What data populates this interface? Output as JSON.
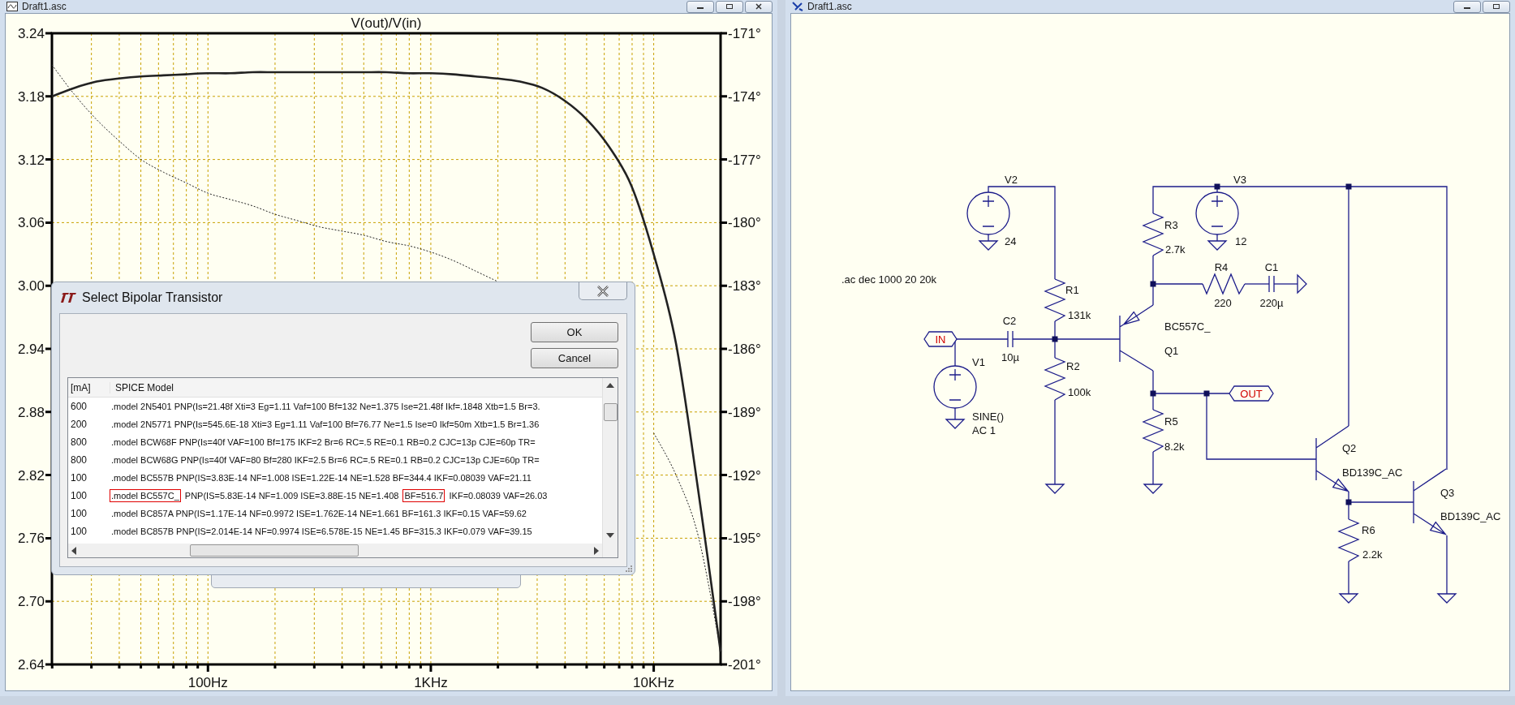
{
  "plot_window": {
    "title": "Draft1.asc",
    "chart_data": {
      "type": "line",
      "title": "V(out)/V(in)",
      "categories": [
        null,
        null,
        null,
        null,
        null,
        null,
        null,
        "100Hz",
        null,
        null,
        null,
        null,
        null,
        null,
        null,
        null,
        null,
        "1KHz",
        null,
        null,
        null,
        null,
        null,
        null,
        null,
        null,
        null,
        "10KHz",
        null,
        null,
        null
      ],
      "ylim": [
        2.64,
        3.24
      ],
      "y2lim": [
        -201,
        -171
      ],
      "grid": true,
      "yticks": [
        {
          "value": 3.24,
          "label": "3.24"
        },
        {
          "value": 3.18,
          "label": "3.18"
        },
        {
          "value": 3.12,
          "label": "3.12"
        },
        {
          "value": 3.06,
          "label": "3.06"
        },
        {
          "value": 3.0,
          "label": "3.00"
        },
        {
          "value": 2.94,
          "label": "2.94"
        },
        {
          "value": 2.88,
          "label": "2.88"
        },
        {
          "value": 2.82,
          "label": "2.82"
        },
        {
          "value": 2.76,
          "label": "2.76"
        },
        {
          "value": 2.7,
          "label": "2.70"
        },
        {
          "value": 2.64,
          "label": "2.64"
        }
      ],
      "y2ticks": [
        {
          "value": -171,
          "label": "-171°"
        },
        {
          "value": -174,
          "label": "-174°"
        },
        {
          "value": -177,
          "label": "-177°"
        },
        {
          "value": -180,
          "label": "-180°"
        },
        {
          "value": -183,
          "label": "-183°"
        },
        {
          "value": -186,
          "label": "-186°"
        },
        {
          "value": -189,
          "label": "-189°"
        },
        {
          "value": -192,
          "label": "-192°"
        },
        {
          "value": -195,
          "label": "-195°"
        },
        {
          "value": -198,
          "label": "-198°"
        },
        {
          "value": -201,
          "label": "-201°"
        }
      ],
      "series": [
        {
          "values": [
            3.18,
            3.188,
            3.194,
            3.197,
            3.199,
            3.2,
            3.201,
            3.202,
            3.202,
            3.203,
            3.203,
            3.203,
            3.203,
            3.203,
            3.203,
            3.203,
            3.202,
            3.202,
            3.201,
            3.199,
            3.197,
            3.194,
            3.188,
            3.176,
            3.158,
            3.132,
            3.095,
            3.03,
            2.945,
            2.805,
            2.652
          ]
        },
        {
          "axis": "y2",
          "line_style": "dotted",
          "values": [
            -172.5,
            -173.9,
            -175.1,
            -176.1,
            -177,
            -177.6,
            -178.1,
            -178.6,
            -178.9,
            -179.2,
            -179.6,
            -179.9,
            -180.2,
            -180.4,
            -180.6,
            -180.9,
            -181.1,
            -181.4,
            -181.8,
            -182.3,
            -182.8,
            null,
            null,
            null,
            null,
            null,
            null,
            -190,
            -192,
            -194.9,
            -200.3
          ]
        }
      ]
    }
  },
  "dialog": {
    "title": "Select Bipolar Transistor",
    "buttons": [
      "OK",
      "Cancel"
    ],
    "columns": [
      "[mA]",
      "SPICE Model"
    ],
    "rows": [
      {
        "current": "600",
        "model": [
          {
            "text": ".model 2N5401 PNP(Is=21.48f Xti=3 Eg=1.11 Vaf=100 Bf=132 Ne=1.375 Ise=21.48f Ikf=.1848 Xtb=1.5 Br=3.",
            "highlighted": false
          }
        ]
      },
      {
        "current": "200",
        "model": [
          {
            "text": ".model 2N5771 PNP(Is=545.6E-18 Xti=3 Eg=1.11 Vaf=100 Bf=76.77 Ne=1.5 Ise=0 Ikf=50m Xtb=1.5 Br=1.36",
            "highlighted": false
          }
        ]
      },
      {
        "current": "800",
        "model": [
          {
            "text": ".model BCW68F PNP(Is=40f VAF=100 Bf=175 IKF=2 Br=6 RC=.5 RE=0.1 RB=0.2 CJC=13p CJE=60p TR=",
            "highlighted": false
          }
        ]
      },
      {
        "current": "800",
        "model": [
          {
            "text": ".model BCW68G PNP(Is=40f VAF=80 Bf=280 IKF=2.5 Br=6 RC=.5 RE=0.1 RB=0.2 CJC=13p CJE=60p TR=",
            "highlighted": false
          }
        ]
      },
      {
        "current": "100",
        "model": [
          {
            "text": ".model BC557B PNP(IS=3.83E-14 NF=1.008 ISE=1.22E-14 NE=1.528 BF=344.4 IKF=0.08039 VAF=21.11",
            "highlighted": false
          }
        ]
      },
      {
        "current": "100",
        "model": [
          {
            "text": ".model BC557C_",
            "highlighted": true
          },
          {
            "text": " PNP(IS=5.83E-14 NF=1.009 ISE=3.88E-15 NE=1.408 ",
            "highlighted": false
          },
          {
            "text": "BF=516.7",
            "highlighted": true
          },
          {
            "text": " IKF=0.08039 VAF=26.03",
            "highlighted": false
          }
        ]
      },
      {
        "current": "100",
        "model": [
          {
            "text": ".model BC857A PNP(IS=1.17E-14 NF=0.9972 ISE=1.762E-14 NE=1.661 BF=161.3 IKF=0.15 VAF=59.62",
            "highlighted": false
          }
        ]
      },
      {
        "current": "100",
        "model": [
          {
            "text": ".model BC857B PNP(IS=2.014E-14 NF=0.9974 ISE=6.578E-15 NE=1.45 BF=315.3 IKF=0.079 VAF=39.15",
            "highlighted": false
          }
        ]
      }
    ]
  },
  "schematic_window": {
    "title": "Draft1.asc",
    "directive": ".ac dec 1000 20 20k",
    "components": [
      {
        "kind": "voltage_source",
        "name": "V2",
        "values": [
          "24"
        ]
      },
      {
        "kind": "resistor",
        "name": "R3",
        "values": [
          "2.7k"
        ]
      },
      {
        "kind": "voltage_source",
        "name": "V3",
        "values": [
          "12"
        ]
      },
      {
        "kind": "resistor",
        "name": "R1",
        "values": [
          "131k"
        ]
      },
      {
        "kind": "resistor",
        "name": "R4",
        "values": [
          "220"
        ]
      },
      {
        "kind": "capacitor",
        "name": "C1",
        "values": [
          "220µ"
        ]
      },
      {
        "kind": "capacitor",
        "name": "C2",
        "values": [
          "10µ"
        ]
      },
      {
        "kind": "pnp",
        "name": "Q1",
        "values": [
          "BC557C_"
        ]
      },
      {
        "kind": "voltage_source",
        "name": "V1",
        "values": [
          "SINE()",
          "AC 1"
        ]
      },
      {
        "kind": "resistor",
        "name": "R2",
        "values": [
          "100k"
        ]
      },
      {
        "kind": "resistor",
        "name": "R5",
        "values": [
          "8.2k"
        ]
      },
      {
        "kind": "npn",
        "name": "Q2",
        "values": [
          "BD139C_AC"
        ]
      },
      {
        "kind": "resistor",
        "name": "R6",
        "values": [
          "2.2k"
        ]
      },
      {
        "kind": "npn",
        "name": "Q3",
        "values": [
          "BD139C_AC"
        ]
      }
    ],
    "net_labels": [
      {
        "text": "IN"
      },
      {
        "text": "OUT"
      }
    ]
  }
}
